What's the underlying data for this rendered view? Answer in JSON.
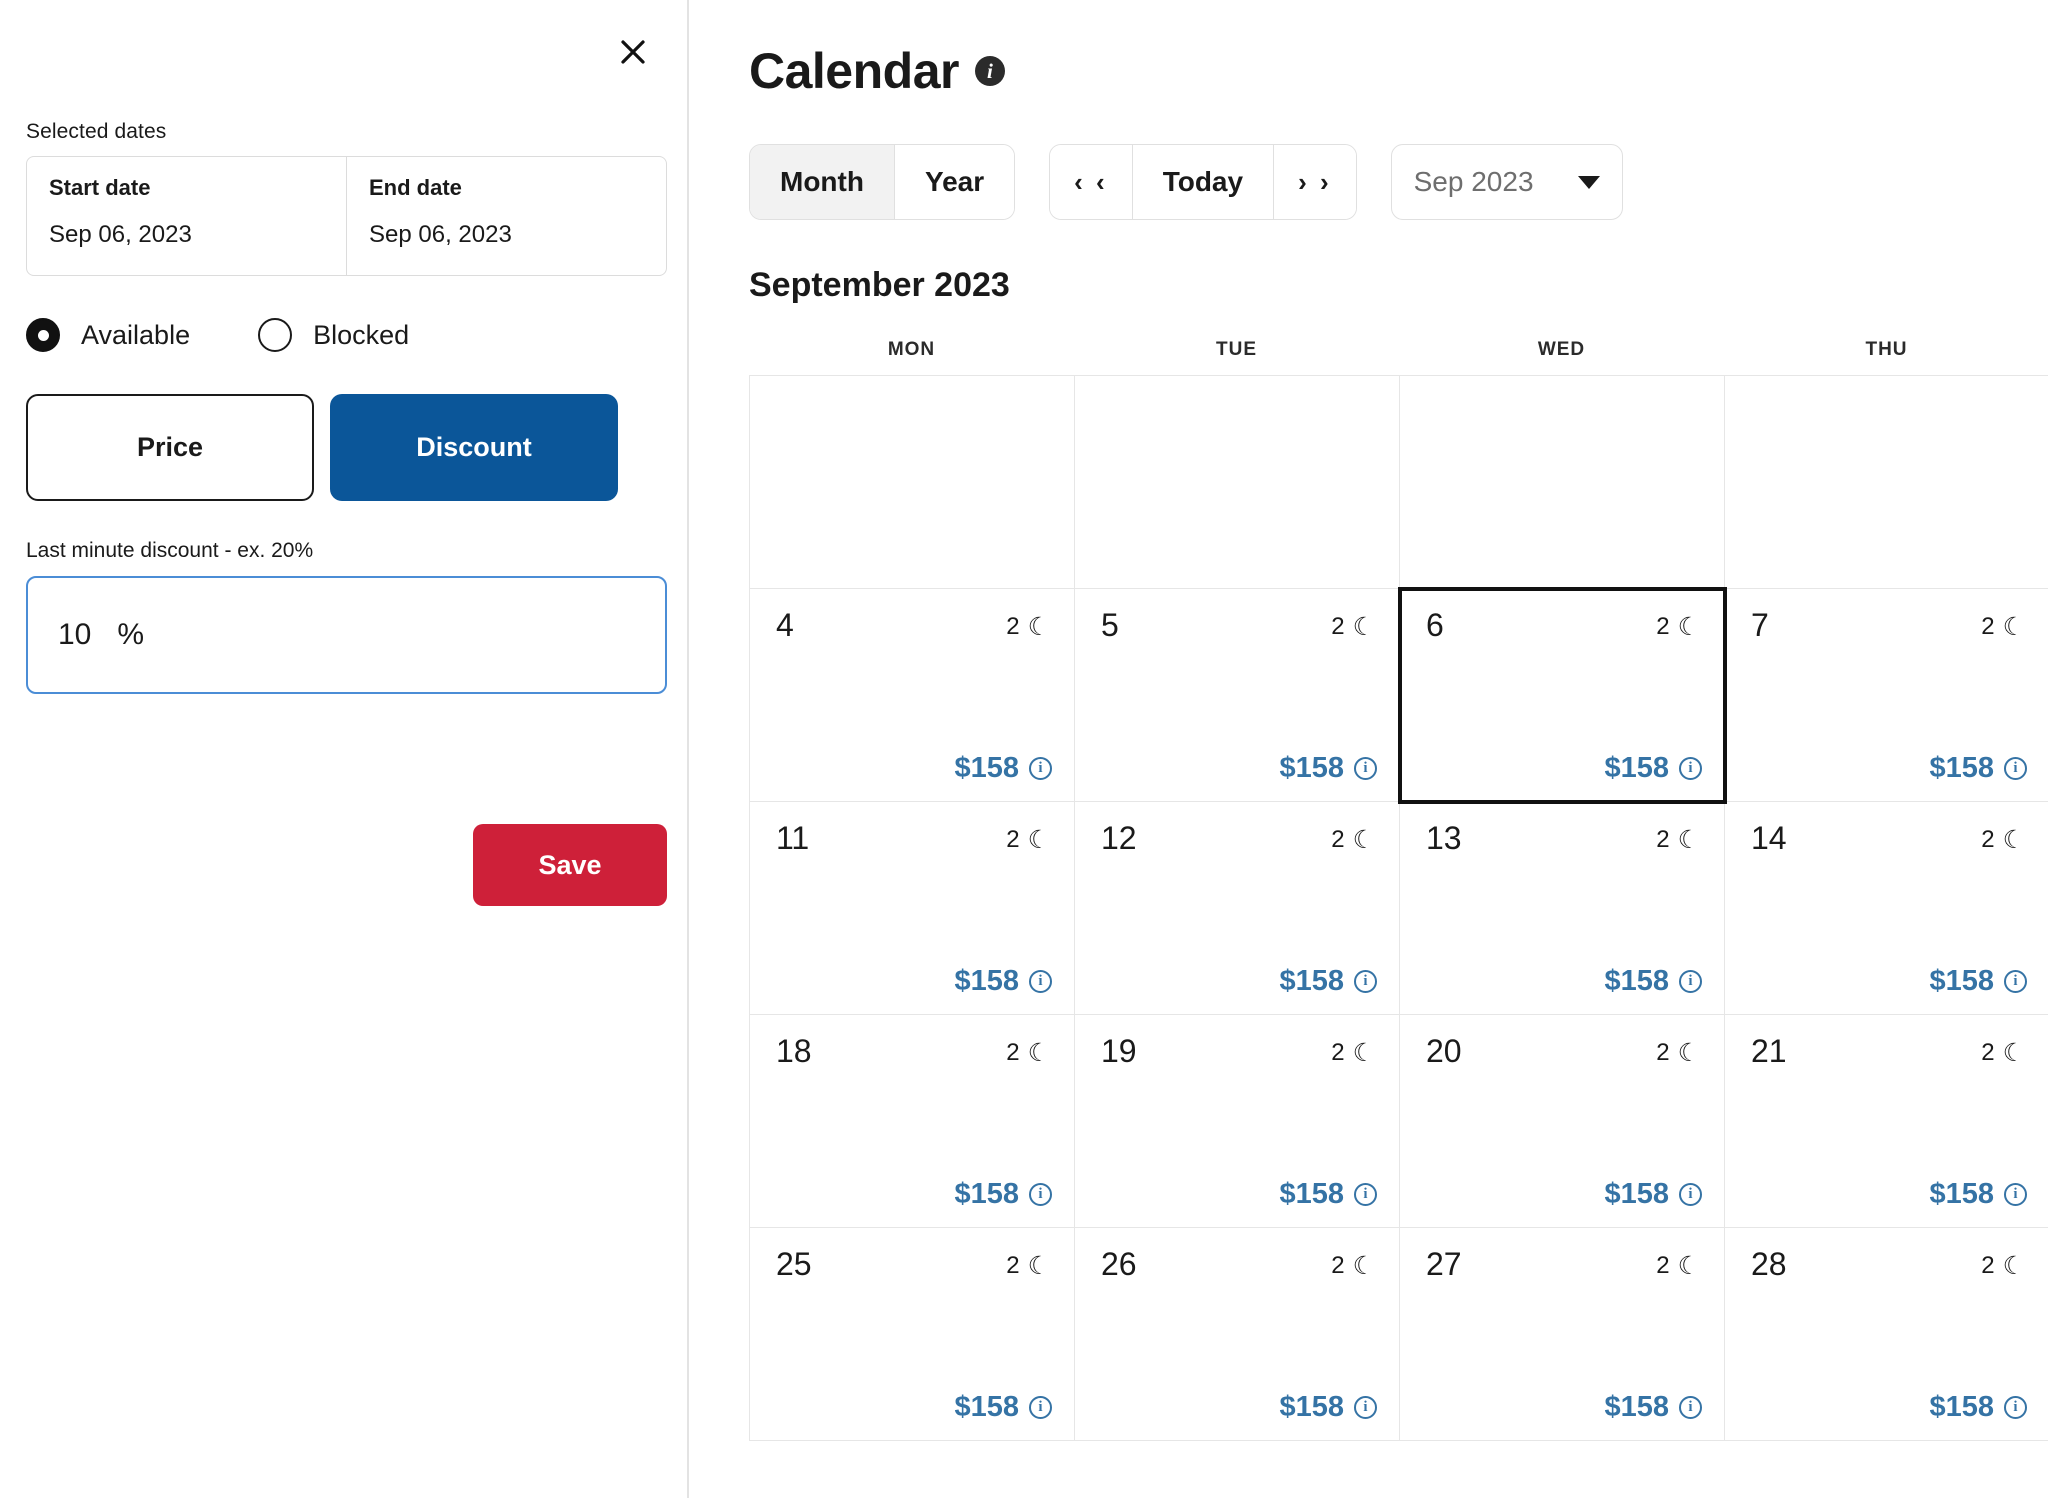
{
  "panel": {
    "close_icon": "close-icon",
    "selected_dates_label": "Selected dates",
    "start_date_title": "Start date",
    "start_date_value": "Sep 06, 2023",
    "end_date_title": "End date",
    "end_date_value": "Sep 06, 2023",
    "availability_options": [
      {
        "label": "Available",
        "selected": true
      },
      {
        "label": "Blocked",
        "selected": false
      }
    ],
    "mode_buttons": [
      {
        "label": "Price",
        "active": false
      },
      {
        "label": "Discount",
        "active": true
      }
    ],
    "discount_hint": "Last minute discount - ex. 20%",
    "discount_value": "10",
    "discount_unit": "%",
    "save_label": "Save",
    "colors": {
      "discount_active": "#0B5699",
      "save": "#CE2039",
      "input_focus_border": "#4B8DD6"
    }
  },
  "calendar": {
    "title": "Calendar",
    "info_icon": "info-icon",
    "view_buttons": [
      {
        "label": "Month",
        "active": true
      },
      {
        "label": "Year",
        "active": false
      }
    ],
    "nav_buttons": [
      {
        "label": "‹ ‹",
        "name": "prev"
      },
      {
        "label": "Today",
        "name": "today"
      },
      {
        "label": "› ›",
        "name": "next"
      }
    ],
    "month_select_value": "Sep 2023",
    "month_heading": "September 2023",
    "day_headers": [
      "MON",
      "TUE",
      "WED",
      "THU"
    ],
    "weeks": [
      [
        {
          "empty": true
        },
        {
          "empty": true
        },
        {
          "empty": true
        },
        {
          "empty": true
        }
      ],
      [
        {
          "day": "4",
          "nights": "2",
          "price": "$158",
          "selected": false
        },
        {
          "day": "5",
          "nights": "2",
          "price": "$158",
          "selected": false
        },
        {
          "day": "6",
          "nights": "2",
          "price": "$158",
          "selected": true
        },
        {
          "day": "7",
          "nights": "2",
          "price": "$158",
          "selected": false
        }
      ],
      [
        {
          "day": "11",
          "nights": "2",
          "price": "$158",
          "selected": false
        },
        {
          "day": "12",
          "nights": "2",
          "price": "$158",
          "selected": false
        },
        {
          "day": "13",
          "nights": "2",
          "price": "$158",
          "selected": false
        },
        {
          "day": "14",
          "nights": "2",
          "price": "$158",
          "selected": false
        }
      ],
      [
        {
          "day": "18",
          "nights": "2",
          "price": "$158",
          "selected": false
        },
        {
          "day": "19",
          "nights": "2",
          "price": "$158",
          "selected": false
        },
        {
          "day": "20",
          "nights": "2",
          "price": "$158",
          "selected": false
        },
        {
          "day": "21",
          "nights": "2",
          "price": "$158",
          "selected": false
        }
      ],
      [
        {
          "day": "25",
          "nights": "2",
          "price": "$158",
          "selected": false
        },
        {
          "day": "26",
          "nights": "2",
          "price": "$158",
          "selected": false
        },
        {
          "day": "27",
          "nights": "2",
          "price": "$158",
          "selected": false
        },
        {
          "day": "28",
          "nights": "2",
          "price": "$158",
          "selected": false
        }
      ]
    ],
    "moon_icon": "☾",
    "price_info_icon": "i",
    "price_color": "#3573A5"
  }
}
